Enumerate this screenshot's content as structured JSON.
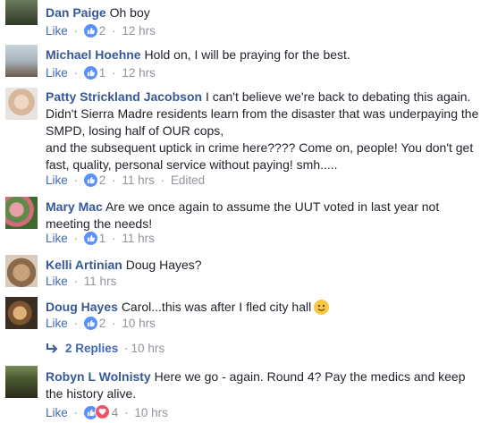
{
  "comments": [
    {
      "name": "Dan Paige",
      "text": "Oh boy",
      "action": "Like",
      "reactions": "2",
      "time": "12 hrs",
      "edited": ""
    },
    {
      "name": "Michael Hoehne",
      "text": "Hold on, I will be praying for the best.",
      "action": "Like",
      "reactions": "1",
      "time": "12 hrs",
      "edited": ""
    },
    {
      "name": "Patty Strickland Jacobson",
      "text": "I can't believe we're back to debating this again. Didn't Sierra Madre residents learn from the disaster that was underpaying the SMPD, losing half of OUR cops,",
      "text2": "and the subsequent uptick in crime here???? Come on, people! You don't get fast, quality, personal service without paying! smh.....",
      "action": "Like",
      "reactions": "2",
      "time": "11 hrs",
      "edited": "Edited"
    },
    {
      "name": "Mary Mac",
      "text": "Are we once again to assume the UUT voted in last year not meeting the needs!",
      "action": "Like",
      "reactions": "1",
      "time": "11 hrs",
      "edited": ""
    },
    {
      "name": "Kelli Artinian",
      "text": "Doug Hayes?",
      "action": "Like",
      "reactions": "",
      "time": "11 hrs",
      "edited": ""
    },
    {
      "name": "Doug Hayes",
      "text": "Carol...this was after I fled city hall",
      "action": "Like",
      "reactions": "2",
      "time": "10 hrs",
      "edited": ""
    },
    {
      "name": "Robyn L Wolnisty",
      "text": "Here we go - again. Round 4? Pay the medics and keep the history alive.",
      "action": "Like",
      "reactions": "4",
      "time": "10 hrs",
      "edited": ""
    }
  ],
  "replies": {
    "label": "2 Replies",
    "time": "10 hrs"
  },
  "separator": "·",
  "icons": {
    "like": "thumbs-up-icon",
    "love": "heart-icon",
    "emoji": "smiley-icon",
    "reply_arrow": "reply-arrow-icon"
  },
  "colors": {
    "name": "#365899",
    "link": "#4267b2",
    "meta": "#90949c",
    "like_badge": "#5890ff",
    "love_badge": "#f25268"
  }
}
